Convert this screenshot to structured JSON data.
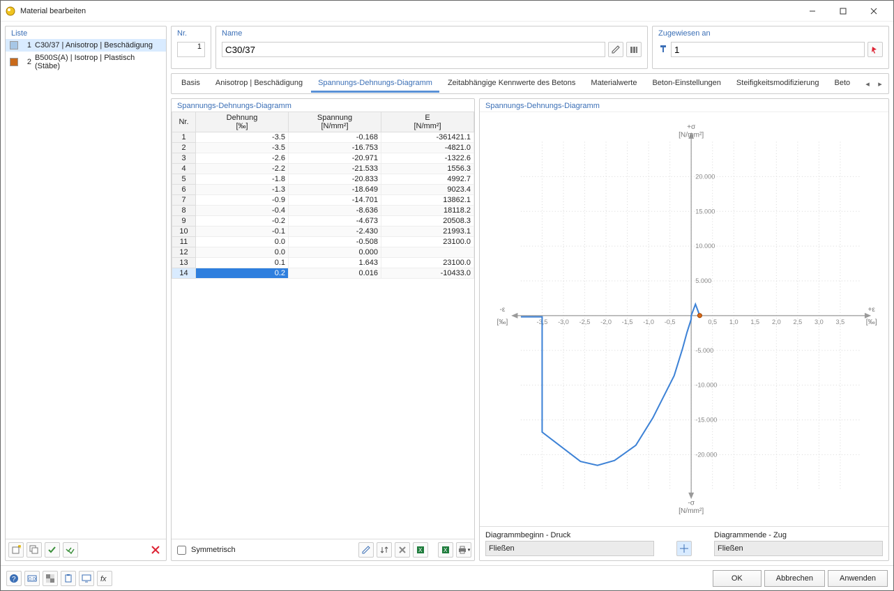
{
  "window": {
    "title": "Material bearbeiten"
  },
  "left": {
    "header": "Liste",
    "items": [
      {
        "num": "1",
        "label": "C30/37 | Anisotrop | Beschädigung",
        "color": "#a7c7e6",
        "selected": true
      },
      {
        "num": "2",
        "label": "B500S(A) | Isotrop | Plastisch (Stäbe)",
        "color": "#c96a1b",
        "selected": false
      }
    ]
  },
  "top": {
    "nr_label": "Nr.",
    "nr_value": "1",
    "name_label": "Name",
    "name_value": "C30/37",
    "assigned_label": "Zugewiesen an",
    "assigned_value": "1"
  },
  "tabs": {
    "items": [
      {
        "label": "Basis"
      },
      {
        "label": "Anisotrop | Beschädigung"
      },
      {
        "label": "Spannungs-Dehnungs-Diagramm",
        "active": true
      },
      {
        "label": "Zeitabhängige Kennwerte des Betons"
      },
      {
        "label": "Materialwerte"
      },
      {
        "label": "Beton-Einstellungen"
      },
      {
        "label": "Steifigkeitsmodifizierung"
      },
      {
        "label": "Beto"
      }
    ]
  },
  "table": {
    "header": "Spannungs-Dehnungs-Diagramm",
    "columns": {
      "nr": "Nr.",
      "dehnung": "Dehnung",
      "dehnung_unit": "[‰]",
      "spannung": "Spannung",
      "spannung_unit": "[N/mm²]",
      "E": "E",
      "E_unit": "[N/mm²]"
    },
    "rows": [
      {
        "nr": "1",
        "dehnung": "-3.5",
        "spannung": "-0.168",
        "E": "-361421.1"
      },
      {
        "nr": "2",
        "dehnung": "-3.5",
        "spannung": "-16.753",
        "E": "-4821.0"
      },
      {
        "nr": "3",
        "dehnung": "-2.6",
        "spannung": "-20.971",
        "E": "-1322.6"
      },
      {
        "nr": "4",
        "dehnung": "-2.2",
        "spannung": "-21.533",
        "E": "1556.3"
      },
      {
        "nr": "5",
        "dehnung": "-1.8",
        "spannung": "-20.833",
        "E": "4992.7"
      },
      {
        "nr": "6",
        "dehnung": "-1.3",
        "spannung": "-18.649",
        "E": "9023.4"
      },
      {
        "nr": "7",
        "dehnung": "-0.9",
        "spannung": "-14.701",
        "E": "13862.1"
      },
      {
        "nr": "8",
        "dehnung": "-0.4",
        "spannung": "-8.636",
        "E": "18118.2"
      },
      {
        "nr": "9",
        "dehnung": "-0.2",
        "spannung": "-4.673",
        "E": "20508.3"
      },
      {
        "nr": "10",
        "dehnung": "-0.1",
        "spannung": "-2.430",
        "E": "21993.1"
      },
      {
        "nr": "11",
        "dehnung": "0.0",
        "spannung": "-0.508",
        "E": "23100.0"
      },
      {
        "nr": "12",
        "dehnung": "0.0",
        "spannung": "0.000",
        "E": ""
      },
      {
        "nr": "13",
        "dehnung": "0.1",
        "spannung": "1.643",
        "E": "23100.0"
      },
      {
        "nr": "14",
        "dehnung": "0.2",
        "spannung": "0.016",
        "E": "-10433.0",
        "selected": true
      }
    ],
    "symmetric_label": "Symmetrisch"
  },
  "chart": {
    "header": "Spannungs-Dehnungs-Diagramm",
    "x_label_pos": "+ε",
    "x_label_neg": "-ε",
    "x_unit": "[‰]",
    "y_label_pos": "+σ",
    "y_label_neg": "-σ",
    "y_unit": "[N/mm²]",
    "diag_start_label": "Diagrammbeginn - Druck",
    "diag_start_value": "Fließen",
    "diag_end_label": "Diagrammende - Zug",
    "diag_end_value": "Fließen"
  },
  "buttons": {
    "ok": "OK",
    "cancel": "Abbrechen",
    "apply": "Anwenden"
  },
  "chart_data": {
    "type": "line",
    "x": [
      -3.5,
      -3.5,
      -2.6,
      -2.2,
      -1.8,
      -1.3,
      -0.9,
      -0.4,
      -0.2,
      -0.1,
      0.0,
      0.0,
      0.1,
      0.2
    ],
    "y": [
      -0.168,
      -16.753,
      -20.971,
      -21.533,
      -20.833,
      -18.649,
      -14.701,
      -8.636,
      -4.673,
      -2.43,
      -0.508,
      0.0,
      1.643,
      0.016
    ],
    "title": "Spannungs-Dehnungs-Diagramm",
    "xlabel": "ε [‰]",
    "ylabel": "σ [N/mm²]",
    "xlim": [
      -4,
      4
    ],
    "ylim": [
      -25000,
      25000
    ],
    "x_ticks": [
      -3.5,
      -3.0,
      -2.5,
      -2.0,
      -1.5,
      -1.0,
      -0.5,
      0.5,
      1.0,
      1.5,
      2.0,
      2.5,
      3.0,
      3.5
    ],
    "y_ticks": [
      -20000,
      -15000,
      -10000,
      -5000,
      5000,
      10000,
      15000,
      20000
    ],
    "y_tick_labels": [
      "-20.000",
      "-15.000",
      "-10.000",
      "-5.000",
      "5.000",
      "10.000",
      "15.000",
      "20.000"
    ]
  }
}
